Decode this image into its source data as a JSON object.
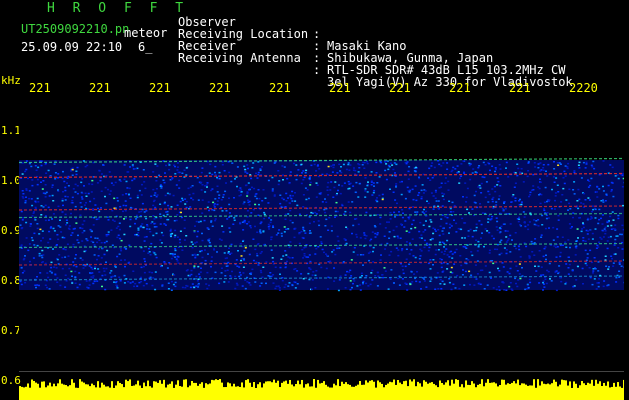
{
  "header": {
    "app_name": "H R O F F T",
    "filename": "UT2509092210.pn",
    "mode": "meteor",
    "datetime": "25.09.09 22:10",
    "count": "6_"
  },
  "info": {
    "rows": [
      {
        "key": "Observer",
        "sep": ":",
        "value": "Masaki Kano"
      },
      {
        "key": "Receiving Location",
        "sep": ":",
        "value": "Shibukawa, Gunma, Japan"
      },
      {
        "key": "Receiver",
        "sep": ":",
        "value": "RTL-SDR SDR# 43dB L15 103.2MHz CW"
      },
      {
        "key": "Receiving Antenna",
        "sep": ":",
        "value": "3el Yagi(V) Az 330 for Vladivostok"
      }
    ]
  },
  "chart_data": {
    "type": "heatmap",
    "ylabel": "kHz",
    "x_ticks": [
      "221",
      "221",
      "221",
      "221",
      "221",
      "221",
      "221",
      "221",
      "221",
      "2220"
    ],
    "y_ticks": [
      "1.1",
      "1.0",
      "0.9",
      "0.8",
      "0.7",
      "0.6"
    ],
    "ylim": [
      0.6,
      1.1
    ],
    "signal_band": [
      0.78,
      1.04
    ],
    "colors": {
      "background": "#000000",
      "tick_text": "#ffff00",
      "meter": "#ffff00",
      "low": "#0010a0",
      "mid": "#00a0ff",
      "high": "#ff2000"
    }
  }
}
